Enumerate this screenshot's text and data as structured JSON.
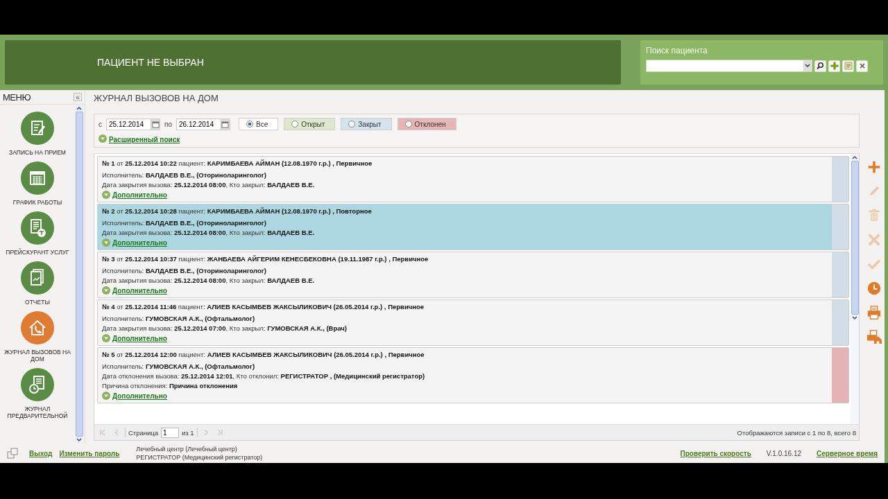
{
  "header": {
    "patient": "ПАЦИЕНТ НЕ ВЫБРАН",
    "search_label": "Поиск пациента",
    "search_buttons": [
      {
        "kind": "search"
      },
      {
        "kind": "add"
      },
      {
        "kind": "edit"
      },
      {
        "kind": "close"
      }
    ]
  },
  "sidebar": {
    "title": "МЕНЮ",
    "collapse": "«",
    "items": [
      {
        "label": "ЗАПИСЬ НА ПРИЕМ",
        "kind": "document",
        "selected": false
      },
      {
        "label": "ГРАФИК РАБОТЫ",
        "kind": "calendar",
        "selected": false
      },
      {
        "label": "ПРЕЙСКУРАНТ УСЛУГ",
        "kind": "pricelist",
        "selected": false
      },
      {
        "label": "ОТЧЕТЫ",
        "kind": "report",
        "selected": false
      },
      {
        "label": "ЖУРНАЛ ВЫЗОВОВ НА ДОМ",
        "kind": "house",
        "selected": true
      },
      {
        "label": "ЖУРНАЛ ПРЕДВАРИТЕЛЬНОЙ",
        "kind": "clockdoc",
        "selected": false
      }
    ]
  },
  "page_title": "ЖУРНАЛ ВЫЗОВОВ НА ДОМ",
  "filter": {
    "from_label": "с",
    "from": "25.12.2014",
    "to_label": "по",
    "to": "26.12.2014",
    "statuses": [
      {
        "label": "Все",
        "selected": true,
        "color": "#ffffff"
      },
      {
        "label": "Открыт",
        "selected": false,
        "color": "#dfe8cc"
      },
      {
        "label": "Закрыт",
        "selected": false,
        "color": "#d5e3ef"
      },
      {
        "label": "Отклонен",
        "selected": false,
        "color": "#e8b5b5"
      }
    ],
    "advanced": "Расширенный поиск"
  },
  "records": [
    {
      "kind": "closed",
      "selected": false,
      "lines": [
        "**№ 1** от **25.12.2014 10:22** пациент: **КАРИМБАЕВА АЙМАН (12.08.1970 г.р.) , Первичное**",
        "Исполнитель: **ВАЛДАЕВ В.Е., (Оториноларинголог)**",
        "Дата закрытия вызова: **25.12.2014 08:00**, Кто закрыл: **ВАЛДАЕВ В.Е.**"
      ],
      "link": "Дополнительно"
    },
    {
      "kind": "closed",
      "selected": true,
      "lines": [
        "**№ 2** от **25.12.2014 10:28** пациент: **КАРИМБАЕВА АЙМАН (12.08.1970 г.р.) , Повторное**",
        "Исполнитель: **ВАЛДАЕВ В.Е., (Оториноларинголог)**",
        "Дата закрытия вызова: **25.12.2014 08:00**, Кто закрыл: **ВАЛДАЕВ В.Е.**"
      ],
      "link": "Дополнительно"
    },
    {
      "kind": "closed",
      "selected": false,
      "lines": [
        "**№ 3** от **25.12.2014 10:37** пациент: **ЖАНБАЕВА АЙГЕРИМ КЕНЕСБЕКОВНА (19.11.1987 г.р.) , Первичное**",
        "Исполнитель: **ВАЛДАЕВ В.Е., (Оториноларинголог)**",
        "Дата закрытия вызова: **25.12.2014 08:00**, Кто закрыл: **ВАЛДАЕВ В.Е.**"
      ],
      "link": "Дополнительно"
    },
    {
      "kind": "closed",
      "selected": false,
      "lines": [
        "**№ 4** от **25.12.2014 11:46** пациент: **АЛИЕВ КАСЫМБЕВ ЖАКСЫЛИКОВИЧ (26.05.2014 г.р.) , Первичное**",
        "Исполнитель: **ГУМОВСКАЯ А.К., (Офтальмолог)**",
        "Дата закрытия вызова: **25.12.2014 07:00**, Кто закрыл: **ГУМОВСКАЯ А.К., (Врач)**"
      ],
      "link": "Дополнительно"
    },
    {
      "kind": "rejected",
      "selected": false,
      "lines": [
        "**№ 5** от **25.12.2014 12:00** пациент: **АЛИЕВ КАСЫМБЕВ ЖАКСЫЛИКОВИЧ (26.05.2014 г.р.) , Первичное**",
        "Исполнитель: **ГУМОВСКАЯ А.К., (Офтальмолог)**",
        "Дата отклонения вызова: **25.12.2014 12:01**, Кто отклонил: **РЕГИСТРАТОР , (Медицинский регистратор)**",
        "Причина отклонения: **Причина отклонения**"
      ],
      "link": "Дополнительно"
    }
  ],
  "toolbar": [
    {
      "kind": "add",
      "disabled": false
    },
    {
      "kind": "edit",
      "disabled": true
    },
    {
      "kind": "delete",
      "disabled": true
    },
    {
      "kind": "cancel",
      "disabled": true
    },
    {
      "kind": "confirm",
      "disabled": true
    },
    {
      "kind": "clock",
      "disabled": false
    },
    {
      "kind": "print",
      "disabled": false
    },
    {
      "kind": "printhome",
      "disabled": false
    }
  ],
  "pager": {
    "page_label": "Страница",
    "page": "1",
    "of": "из 1",
    "summary": "Отображаются записи с 1 по 8, всего 8"
  },
  "footer": {
    "logout": "Выход",
    "change_password": "Изменить пароль",
    "org": [
      "Лечебный центр (Лечебный центр)",
      "РЕГИСТРАТОР (Медицинский регистратор)"
    ],
    "speed": "Проверить скорость",
    "version": "V.1.0.16.12",
    "server_time": "Серверное время"
  }
}
